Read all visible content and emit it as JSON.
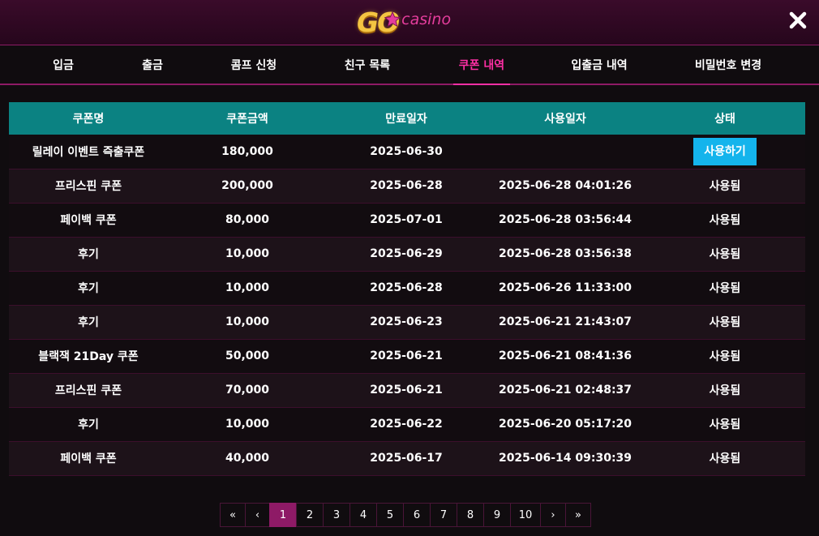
{
  "logo": {
    "go": "GO",
    "casino": "casino"
  },
  "close_icon": "close-icon",
  "colors": {
    "accent": "#ff2fa5",
    "header_row": "#0b8282",
    "use_button": "#14b4ec",
    "page_active": "#8e1a66"
  },
  "tabs": [
    {
      "label": "입금",
      "active": false
    },
    {
      "label": "출금",
      "active": false
    },
    {
      "label": "콤프 신청",
      "active": false
    },
    {
      "label": "친구 목록",
      "active": false
    },
    {
      "label": "쿠폰 내역",
      "active": true
    },
    {
      "label": "입출금 내역",
      "active": false
    },
    {
      "label": "비밀번호 변경",
      "active": false
    }
  ],
  "table": {
    "headers": [
      "쿠폰명",
      "쿠폰금액",
      "만료일자",
      "사용일자",
      "상태"
    ],
    "rows": [
      {
        "name": "릴레이 이벤트 즉출쿠폰",
        "amount": "180,000",
        "expiry": "2025-06-30",
        "used": "",
        "status": "사용하기",
        "action": true
      },
      {
        "name": "프리스핀 쿠폰",
        "amount": "200,000",
        "expiry": "2025-06-28",
        "used": "2025-06-28 04:01:26",
        "status": "사용됨",
        "action": false
      },
      {
        "name": "페이백 쿠폰",
        "amount": "80,000",
        "expiry": "2025-07-01",
        "used": "2025-06-28 03:56:44",
        "status": "사용됨",
        "action": false
      },
      {
        "name": "후기",
        "amount": "10,000",
        "expiry": "2025-06-29",
        "used": "2025-06-28 03:56:38",
        "status": "사용됨",
        "action": false
      },
      {
        "name": "후기",
        "amount": "10,000",
        "expiry": "2025-06-28",
        "used": "2025-06-26 11:33:00",
        "status": "사용됨",
        "action": false
      },
      {
        "name": "후기",
        "amount": "10,000",
        "expiry": "2025-06-23",
        "used": "2025-06-21 21:43:07",
        "status": "사용됨",
        "action": false
      },
      {
        "name": "블랙잭 21Day 쿠폰",
        "amount": "50,000",
        "expiry": "2025-06-21",
        "used": "2025-06-21 08:41:36",
        "status": "사용됨",
        "action": false
      },
      {
        "name": "프리스핀 쿠폰",
        "amount": "70,000",
        "expiry": "2025-06-21",
        "used": "2025-06-21 02:48:37",
        "status": "사용됨",
        "action": false
      },
      {
        "name": "후기",
        "amount": "10,000",
        "expiry": "2025-06-22",
        "used": "2025-06-20 05:17:20",
        "status": "사용됨",
        "action": false
      },
      {
        "name": "페이백 쿠폰",
        "amount": "40,000",
        "expiry": "2025-06-17",
        "used": "2025-06-14 09:30:39",
        "status": "사용됨",
        "action": false
      }
    ]
  },
  "pagination": {
    "first": "«",
    "prev": "‹",
    "pages": [
      "1",
      "2",
      "3",
      "4",
      "5",
      "6",
      "7",
      "8",
      "9",
      "10"
    ],
    "current": "1",
    "next": "›",
    "last": "»"
  }
}
